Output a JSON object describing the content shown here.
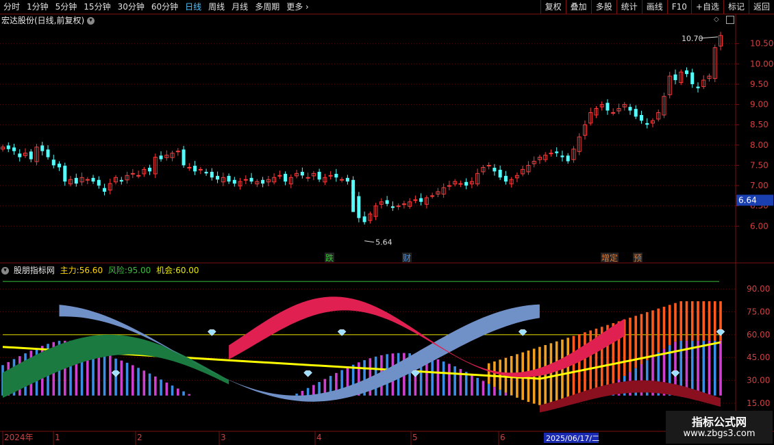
{
  "toolbar": {
    "periods": [
      "分时",
      "1分钟",
      "5分钟",
      "15分钟",
      "30分钟",
      "60分钟",
      "日线",
      "周线",
      "月线",
      "多周期",
      "更多"
    ],
    "active_period": "日线",
    "right_buttons": [
      "复权",
      "叠加",
      "多股",
      "统计",
      "画线",
      "F10",
      "+自选",
      "返回"
    ],
    "mark_label": "标记"
  },
  "main_panel": {
    "stock_title": "宏达股份(日线,前复权)",
    "high_label": "10.70",
    "low_label": "5.64",
    "current_price": "6.64",
    "price_axis": [
      "10.50",
      "10.00",
      "9.50",
      "9.00",
      "8.50",
      "8.00",
      "7.50",
      "7.00",
      "6.50",
      "6.00"
    ],
    "event_markers": [
      {
        "text": "跌",
        "color": "#38c038"
      },
      {
        "text": "财",
        "color": "#4a90e2"
      },
      {
        "text": "增",
        "color": "#e07b39"
      },
      {
        "text": "定",
        "color": "#e07b39"
      },
      {
        "text": "预",
        "color": "#e07b39"
      }
    ]
  },
  "indicator_panel": {
    "name": "股朋指标网",
    "main_force_label": "主力:",
    "main_force_value": "56.60",
    "risk_label": "风险:",
    "risk_value": "95.00",
    "chance_label": "机会:",
    "chance_value": "60.00",
    "axis": [
      "90.00",
      "75.00",
      "60.00",
      "45.00",
      "30.00",
      "15.00"
    ]
  },
  "time_axis": {
    "labels": [
      "2024年",
      "1",
      "2",
      "3",
      "4",
      "5",
      "6"
    ],
    "cursor_date": "2025/06/17/二"
  },
  "watermark": {
    "title": "指标公式网",
    "url": "www.zbgs3.com"
  },
  "chart_data": {
    "type": "candlestick",
    "close_prices": [
      7.95,
      7.9,
      7.85,
      7.7,
      7.8,
      7.65,
      7.95,
      7.85,
      7.7,
      7.5,
      7.45,
      7.1,
      7.15,
      7.05,
      7.2,
      7.15,
      7.1,
      7.0,
      6.85,
      7.05,
      7.2,
      7.1,
      7.25,
      7.3,
      7.25,
      7.4,
      7.35,
      7.7,
      7.65,
      7.75,
      7.8,
      7.85,
      7.5,
      7.45,
      7.35,
      7.4,
      7.3,
      7.2,
      7.15,
      7.2,
      7.1,
      7.05,
      7.1,
      7.15,
      7.1,
      7.1,
      7.05,
      7.15,
      7.2,
      7.25,
      7.1,
      7.2,
      7.3,
      7.25,
      7.2,
      7.3,
      7.15,
      7.2,
      7.25,
      7.2,
      7.15,
      7.1,
      6.8,
      6.2,
      6.1,
      6.3,
      6.5,
      6.6,
      6.55,
      6.45,
      6.5,
      6.55,
      6.6,
      6.65,
      6.6,
      6.7,
      6.75,
      6.85,
      6.95,
      7.0,
      7.1,
      7.05,
      7.0,
      7.1,
      7.3,
      7.45,
      7.5,
      7.35,
      7.2,
      7.1,
      7.15,
      7.25,
      7.4,
      7.5,
      7.6,
      7.7,
      7.75,
      7.8,
      7.8,
      7.7,
      7.6,
      7.9,
      8.2,
      8.5,
      8.8,
      8.9,
      9.0,
      8.85,
      8.8,
      8.9,
      9.0,
      8.85,
      8.7,
      8.6,
      8.5,
      8.6,
      8.8,
      9.2,
      9.7,
      9.6,
      9.8,
      9.75,
      9.5,
      9.4,
      9.6,
      9.7,
      10.4,
      10.7
    ],
    "ylim": [
      5.5,
      10.9
    ],
    "low_point": 5.64,
    "high_point": 10.7,
    "indicator": {
      "ylim": [
        10,
        100
      ],
      "main_force": 56.6,
      "risk": 95.0,
      "chance": 60.0
    }
  }
}
